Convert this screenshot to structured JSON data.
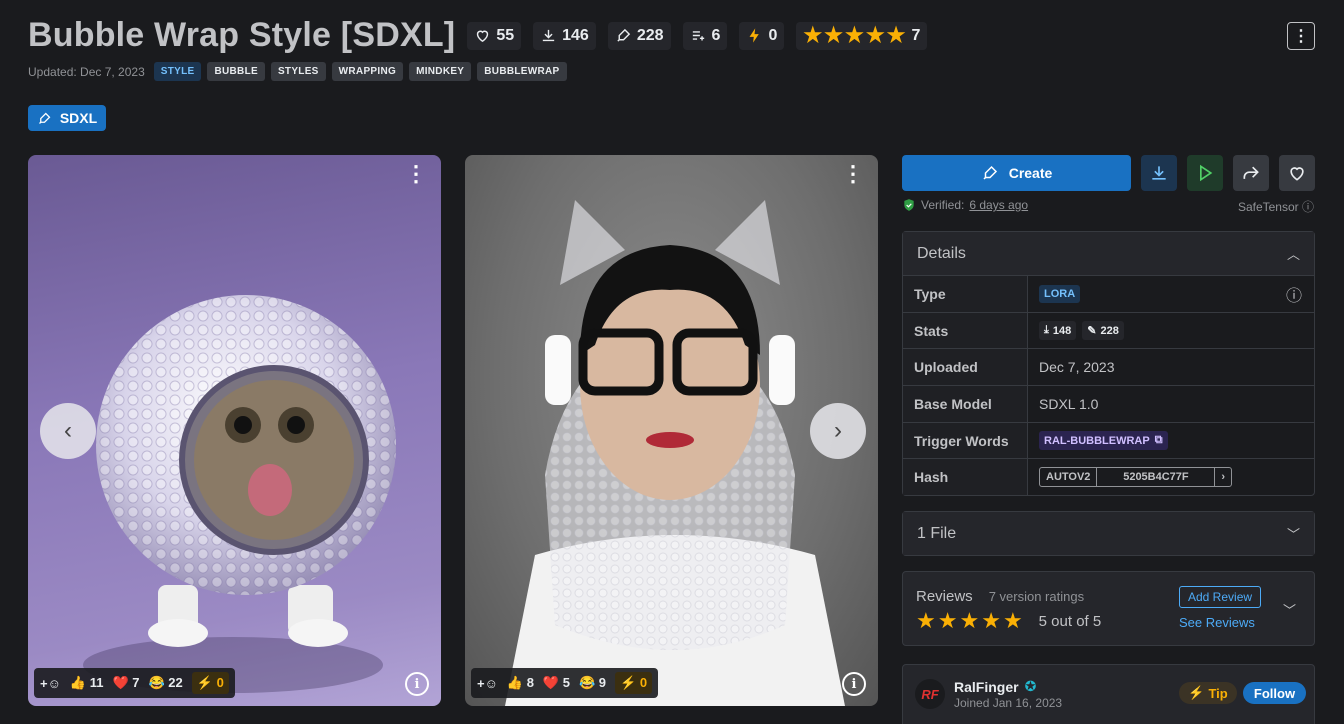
{
  "title": "Bubble Wrap Style [SDXL]",
  "header_stats": {
    "likes": "55",
    "downloads": "146",
    "generations": "228",
    "collections": "6",
    "buzz": "0",
    "rating_count": "7"
  },
  "updated": "Updated: Dec 7, 2023",
  "tags": [
    "STYLE",
    "BUBBLE",
    "STYLES",
    "WRAPPING",
    "MINDKEY",
    "BUBBLEWRAP"
  ],
  "base_badge": "SDXL",
  "gallery": [
    {
      "reactions": {
        "thumbs": "11",
        "hearts": "7",
        "laughs": "22",
        "buzz": "0"
      }
    },
    {
      "reactions": {
        "thumbs": "8",
        "hearts": "5",
        "laughs": "9",
        "buzz": "0"
      }
    }
  ],
  "actions": {
    "create_label": "Create"
  },
  "verified": {
    "label": "Verified:",
    "when": "6 days ago"
  },
  "safetensor": "SafeTensor",
  "details": {
    "heading": "Details",
    "type_key": "Type",
    "type_value": "LORA",
    "stats_key": "Stats",
    "stats_downloads": "148",
    "stats_generations": "228",
    "uploaded_key": "Uploaded",
    "uploaded_value": "Dec 7, 2023",
    "base_key": "Base Model",
    "base_value": "SDXL 1.0",
    "trigger_key": "Trigger Words",
    "trigger_value": "RAL-BUBBLEWRAP",
    "hash_key": "Hash",
    "hash_type": "AUTOV2",
    "hash_value": "5205B4C77F"
  },
  "files": {
    "heading": "1 File"
  },
  "reviews": {
    "heading": "Reviews",
    "count_label": "7 version ratings",
    "score_label": "5 out of 5",
    "add_label": "Add Review",
    "see_label": "See Reviews"
  },
  "creator": {
    "name": "RalFinger",
    "joined": "Joined Jan 16, 2023",
    "tip_label": "Tip",
    "follow_label": "Follow"
  },
  "colors": {
    "accent": "#1971c2",
    "star": "#fab005",
    "bg": "#1a1b1e",
    "panel": "#25262b"
  }
}
